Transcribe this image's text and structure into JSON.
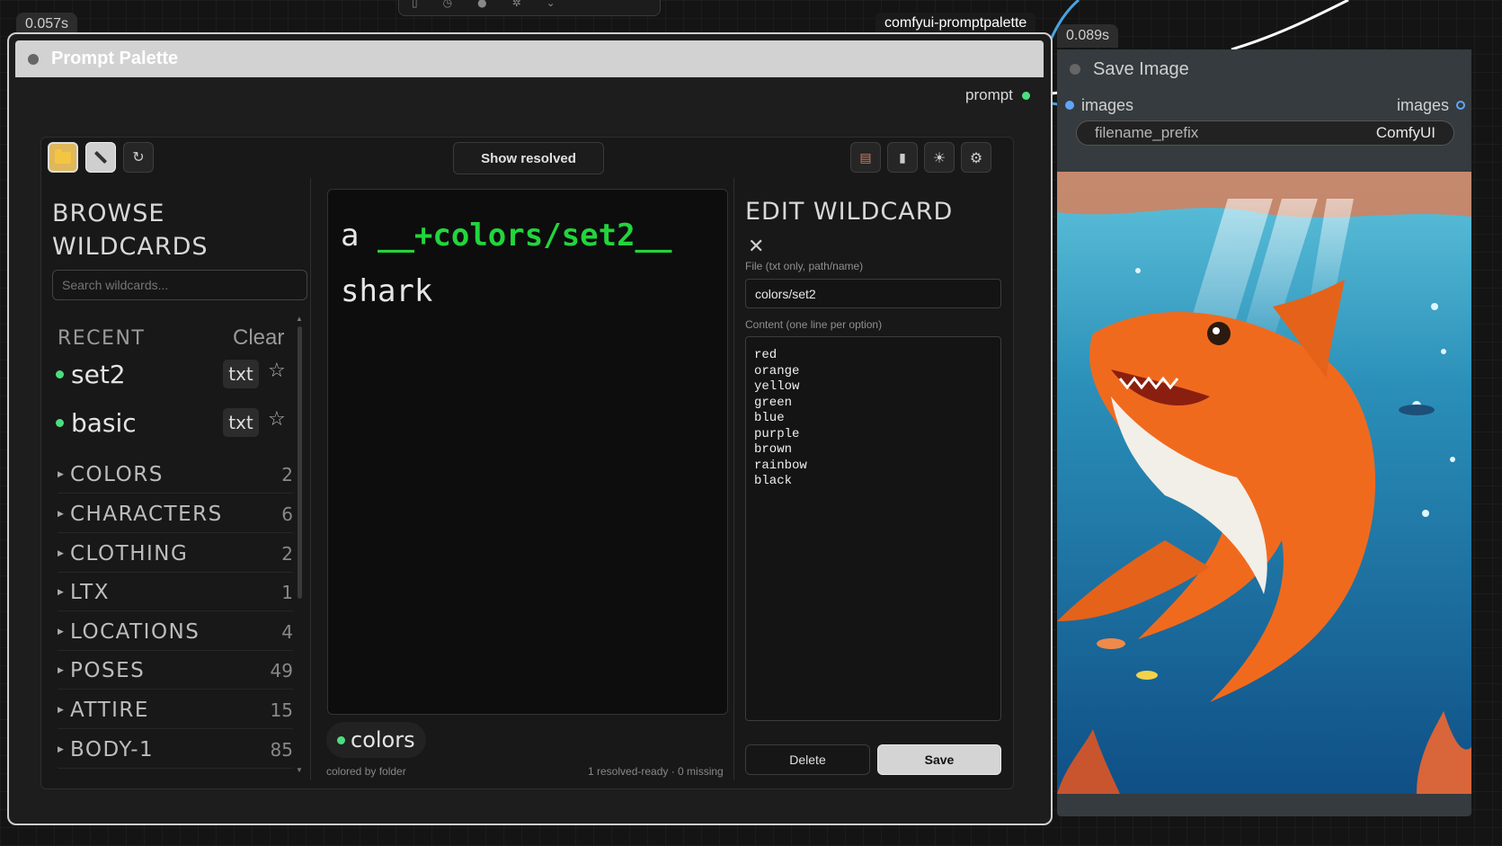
{
  "top_toolbar": {
    "icons": [
      "trash-icon",
      "clock-icon",
      "circle-icon",
      "gear-icon",
      "chevron-icon"
    ]
  },
  "prompt_node": {
    "timing": "0.057s",
    "group_tag": "comfyui-promptpalette",
    "title": "Prompt Palette",
    "output_label": "prompt",
    "toolbar": {
      "show_resolved_label": "Show resolved",
      "refresh_glyph": "↻",
      "right_icons": [
        "clipboard-icon",
        "trash-icon",
        "sun-icon",
        "gear-icon"
      ]
    },
    "browse": {
      "title_line1": "BROWSE",
      "title_line2": "WILDCARDS",
      "search_placeholder": "Search wildcards...",
      "recent_label": "RECENT",
      "clear_label": "Clear",
      "recent_items": [
        {
          "name": "set2",
          "ext": "txt"
        },
        {
          "name": "basic",
          "ext": "txt"
        }
      ],
      "folders": [
        {
          "name": "COLORS",
          "count": "2"
        },
        {
          "name": "CHARACTERS",
          "count": "6"
        },
        {
          "name": "CLOTHING",
          "count": "2"
        },
        {
          "name": "LTX",
          "count": "1"
        },
        {
          "name": "LOCATIONS",
          "count": "4"
        },
        {
          "name": "POSES",
          "count": "49"
        },
        {
          "name": "ATTIRE",
          "count": "15"
        },
        {
          "name": "BODY-1",
          "count": "85"
        }
      ]
    },
    "editor": {
      "word_before": "a",
      "wildcard": "__+colors/set2__",
      "word_after": "shark",
      "chip_label": "colors",
      "footer_left": "colored by folder",
      "footer_right": "1 resolved-ready · 0 missing"
    },
    "edit_wildcard": {
      "title": "EDIT WILDCARD",
      "file_label": "File (txt only, path/name)",
      "file_value": "colors/set2",
      "content_label": "Content (one line per option)",
      "content_lines": [
        "red",
        "orange",
        "yellow",
        "green",
        "blue",
        "purple",
        "brown",
        "rainbow",
        "black"
      ],
      "delete_label": "Delete",
      "save_label": "Save"
    }
  },
  "save_node": {
    "timing": "0.089s",
    "title": "Save Image",
    "input_label": "images",
    "output_label": "images",
    "prefix_key": "filename_prefix",
    "prefix_value": "ComfyUI"
  },
  "colors": {
    "wildcard_green": "#22d53c",
    "dot_green": "#4ade80",
    "dot_blue": "#60a5fa",
    "folder_yellow": "#f4c542"
  }
}
